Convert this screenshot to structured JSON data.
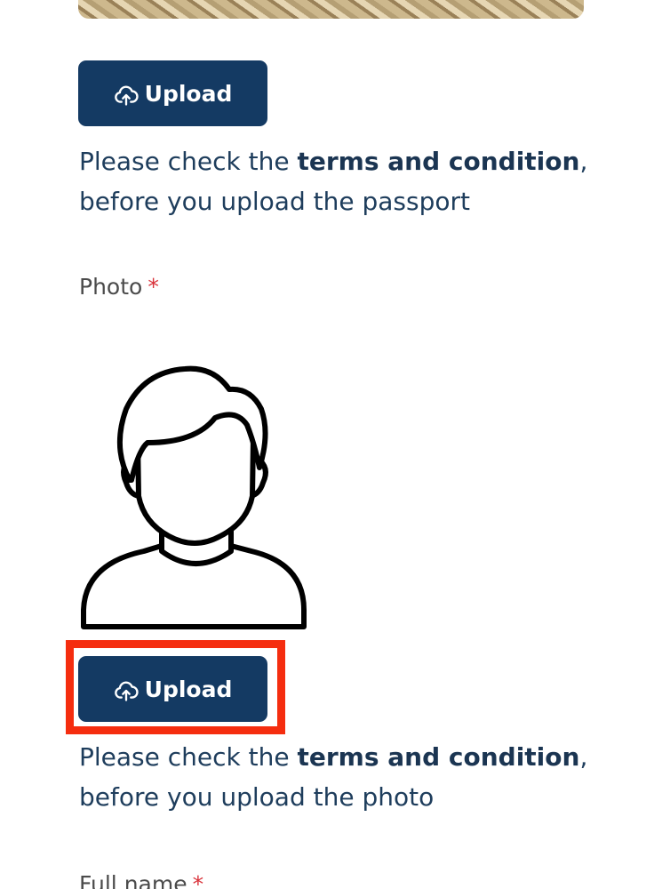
{
  "passport_section": {
    "upload_label": "Upload",
    "terms_prefix": "Please check the ",
    "terms_link": "terms and condition",
    "terms_suffix": ", before you upload the passport"
  },
  "photo_section": {
    "label": "Photo",
    "required_mark": "*",
    "upload_label": "Upload",
    "terms_prefix": "Please check the ",
    "terms_link": "terms and condition",
    "terms_suffix": ", before you upload the photo"
  },
  "full_name_section": {
    "label": "Full name",
    "required_mark": "*"
  },
  "icons": {
    "upload": "cloud-upload-icon",
    "avatar": "user-avatar-placeholder"
  },
  "colors": {
    "button": "#143a63",
    "text": "#1e3d5c",
    "required": "#d9323a",
    "highlight": "#f52d0f"
  }
}
